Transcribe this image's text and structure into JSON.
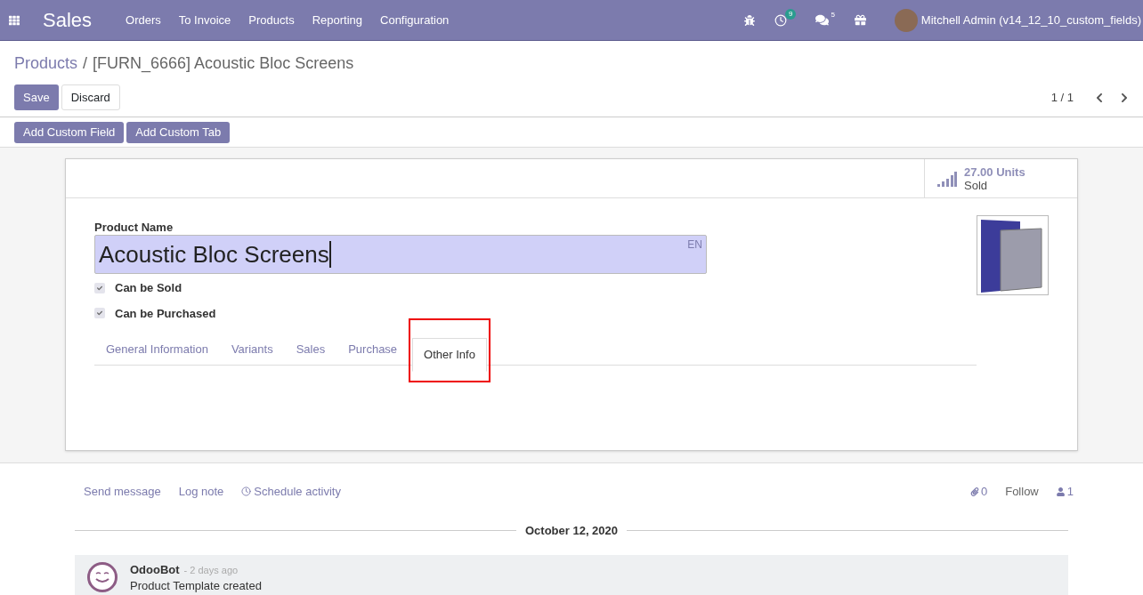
{
  "navbar": {
    "app_name": "Sales",
    "menu": [
      "Orders",
      "To Invoice",
      "Products",
      "Reporting",
      "Configuration"
    ],
    "activity_count": "9",
    "message_count": "5",
    "user": "Mitchell Admin (v14_12_10_custom_fields)"
  },
  "breadcrumb": {
    "parent": "Products",
    "separator": "/",
    "current": "[FURN_6666] Acoustic Bloc Screens"
  },
  "actions": [
    "Save",
    "Discard"
  ],
  "pager": {
    "text": "1 / 1"
  },
  "custom_buttons": [
    "Add Custom Field",
    "Add Custom Tab"
  ],
  "stat_button": {
    "value": "27.00 Units",
    "label": "Sold"
  },
  "form": {
    "name_label": "Product Name",
    "name_value": "Acoustic Bloc Screens",
    "lang": "EN",
    "checkboxes": [
      {
        "label": "Can be Sold",
        "checked": true
      },
      {
        "label": "Can be Purchased",
        "checked": true
      }
    ],
    "tabs": [
      {
        "label": "General Information",
        "selected": false,
        "highlighted": false
      },
      {
        "label": "Variants",
        "selected": false,
        "highlighted": false
      },
      {
        "label": "Sales",
        "selected": false,
        "highlighted": false
      },
      {
        "label": "Purchase",
        "selected": false,
        "highlighted": false
      },
      {
        "label": "Other Info",
        "selected": true,
        "highlighted": true
      }
    ]
  },
  "chatter": {
    "actions": [
      "Send message",
      "Log note",
      "Schedule activity"
    ],
    "attachments": "0",
    "follow": "Follow",
    "followers": "1",
    "date": "October 12, 2020",
    "messages": [
      {
        "author": "OdooBot",
        "time": "- 2 days ago",
        "body": "Product Template created"
      }
    ]
  }
}
